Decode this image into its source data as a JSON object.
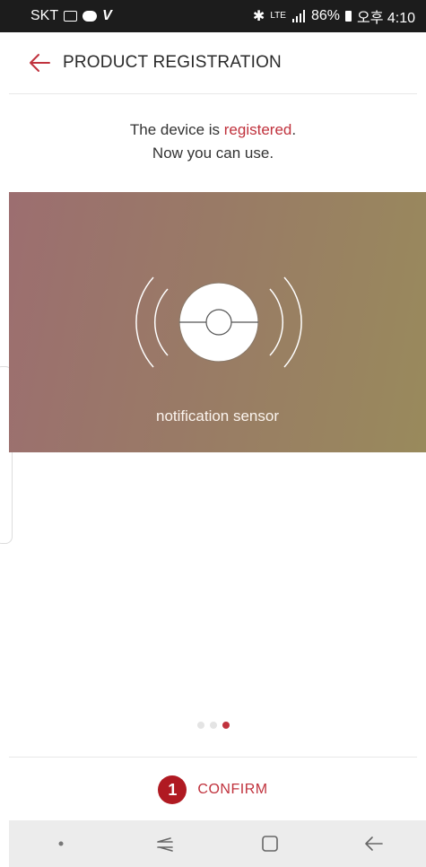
{
  "status_bar": {
    "carrier": "SKT",
    "right_text": "86%",
    "lte_label": "LTE",
    "time": "오후 4:10",
    "icons": [
      "gallery-icon",
      "chat-bubble-icon",
      "v-app-icon",
      "bluetooth-icon",
      "signal-icon",
      "battery-icon"
    ]
  },
  "header": {
    "title": "PRODUCT REGISTRATION",
    "back_icon": "back-arrow-icon"
  },
  "message": {
    "line1_prefix": "The device is ",
    "line1_highlight": "registered",
    "line1_suffix": ".",
    "line2": "Now you can use."
  },
  "device_card": {
    "name": "notification sensor",
    "icon": "notification-sensor-icon"
  },
  "pager": {
    "count": 3,
    "active_index": 2
  },
  "footer": {
    "step_number": "1",
    "confirm_label": "CONFIRM"
  },
  "nav_bar": {
    "buttons": [
      "dot-button",
      "recent-apps-button",
      "home-button",
      "back-button"
    ]
  },
  "colors": {
    "accent": "#c0323d",
    "badge": "#b01a22",
    "status_bar": "#1c1c1c",
    "nav_bar": "#ececec"
  }
}
